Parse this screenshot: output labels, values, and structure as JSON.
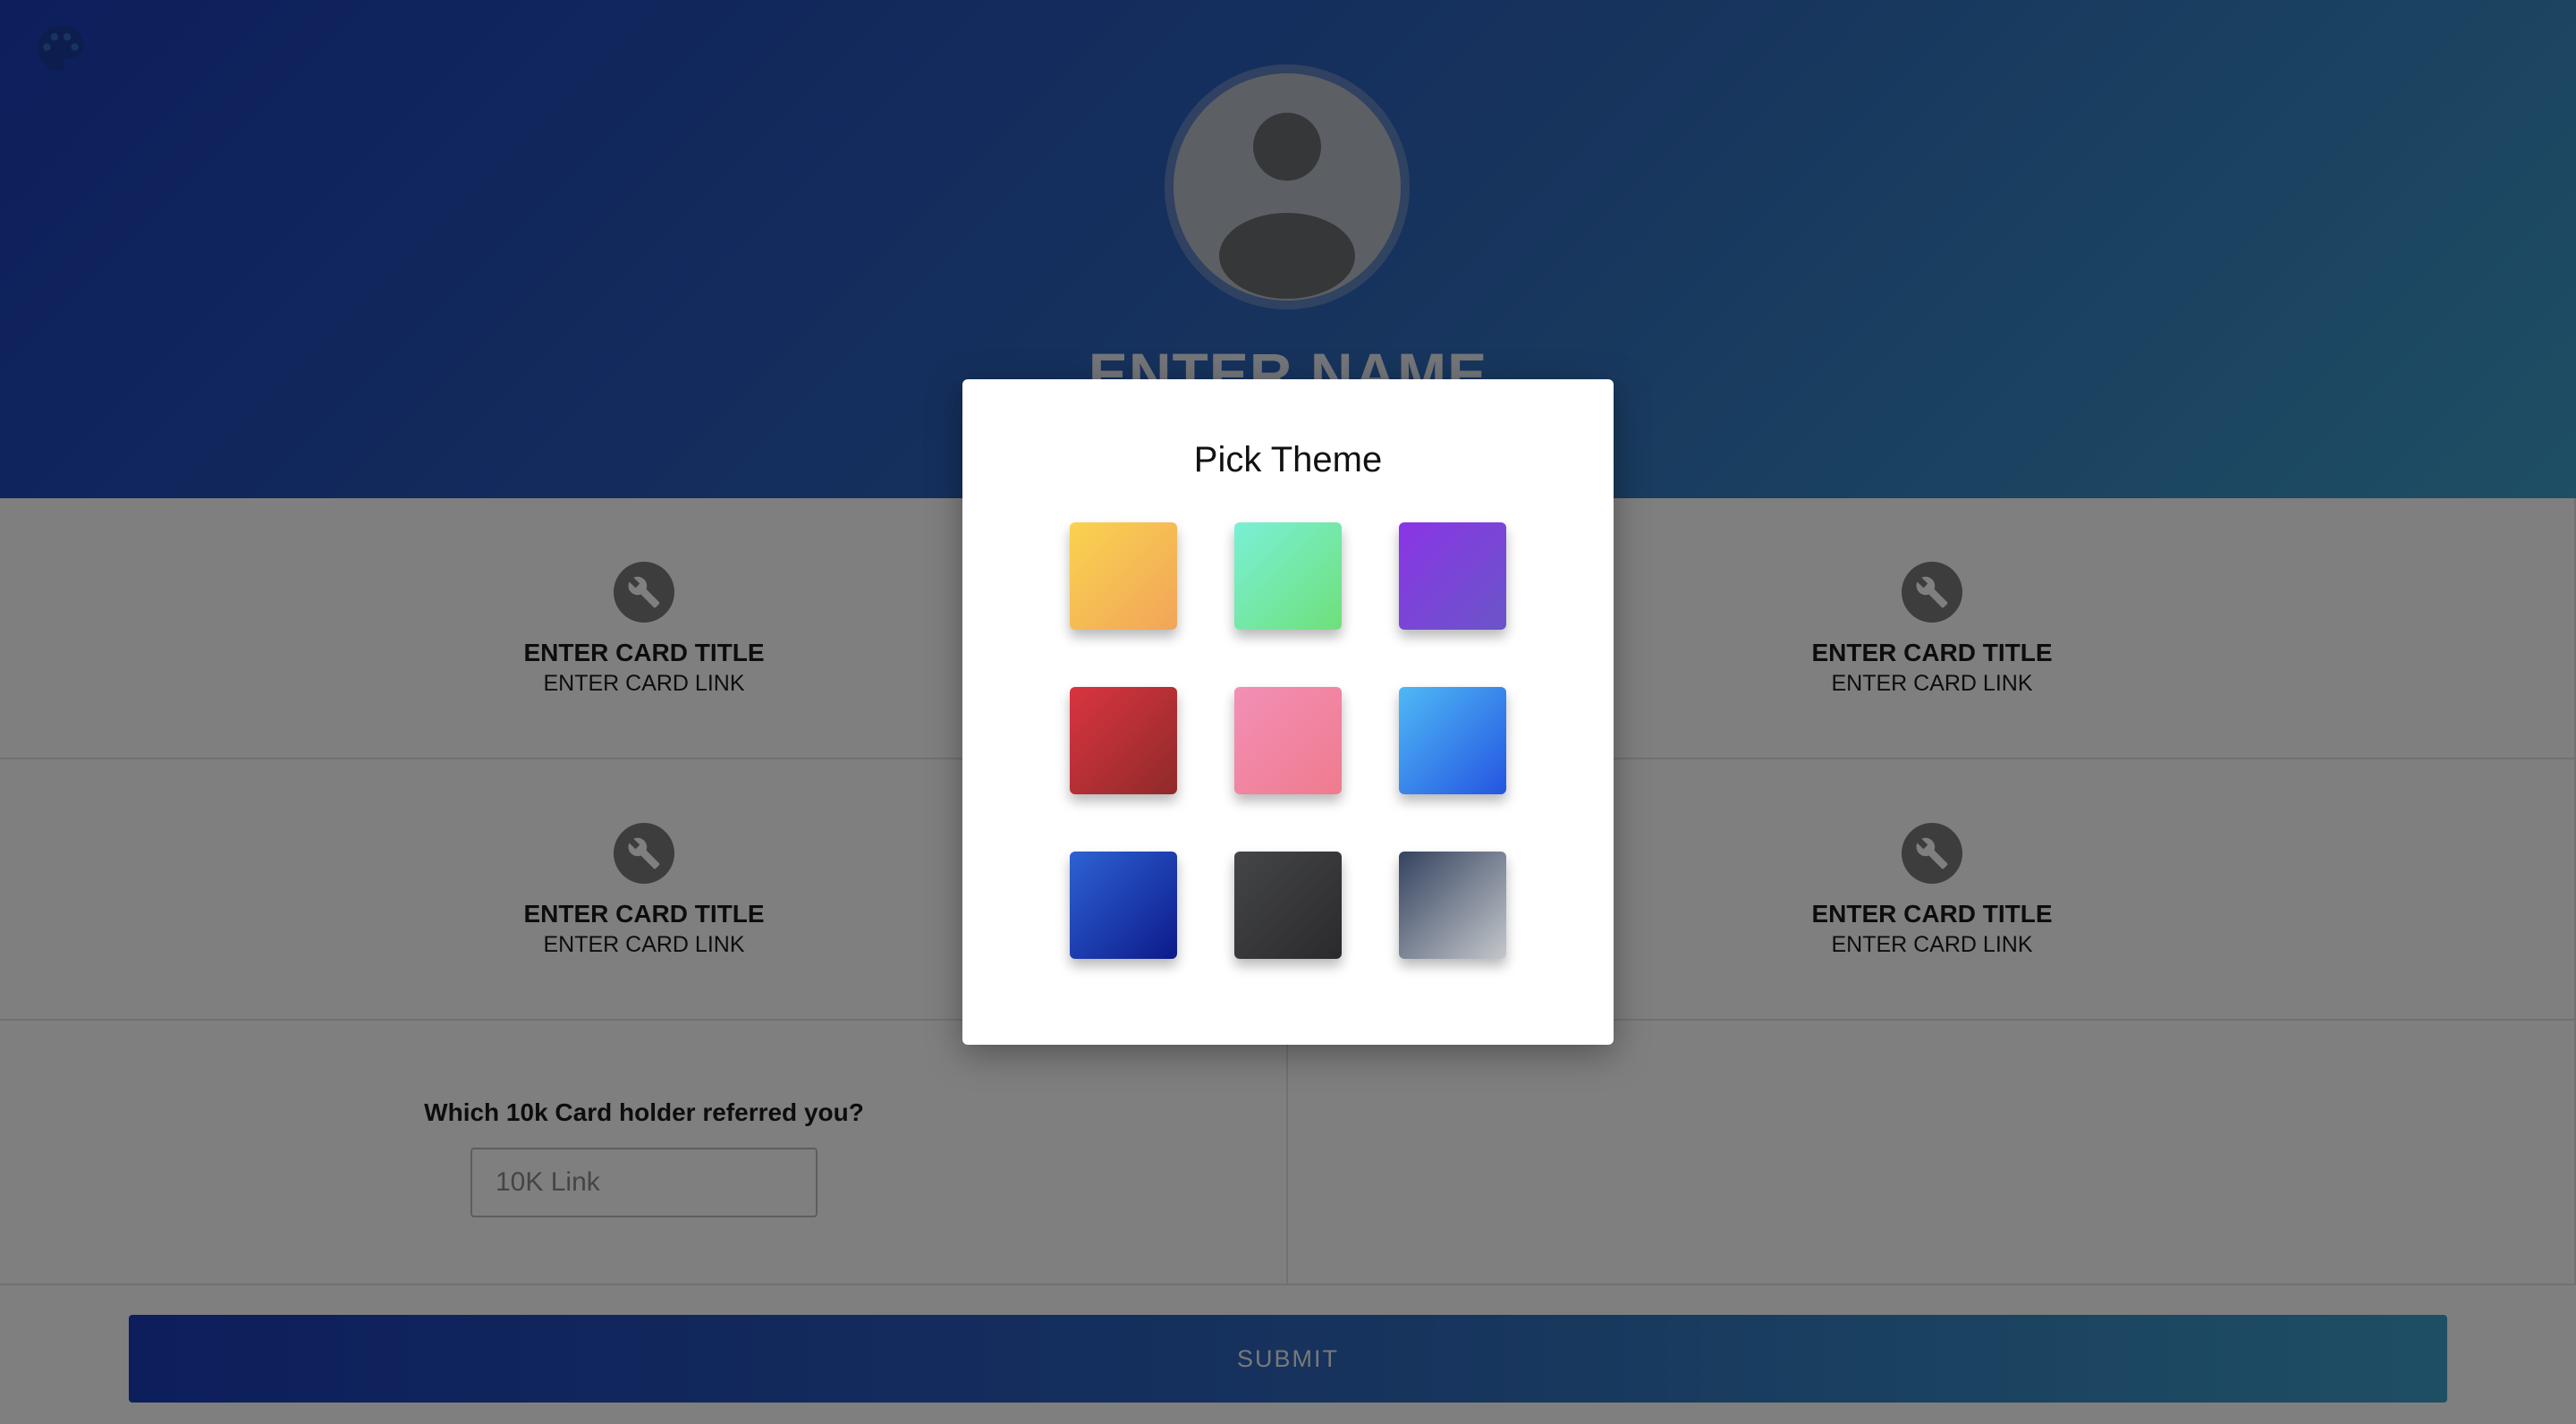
{
  "header": {
    "name_placeholder": "ENTER NAME",
    "palette_icon": "palette-icon",
    "avatar_icon": "user-avatar-icon"
  },
  "cards": [
    {
      "title": "ENTER CARD TITLE",
      "link": "ENTER CARD LINK",
      "icon": "wrench-icon"
    },
    {
      "title": "ENTER CARD TITLE",
      "link": "ENTER CARD LINK",
      "icon": "wrench-icon"
    },
    {
      "title": "ENTER CARD TITLE",
      "link": "ENTER CARD LINK",
      "icon": "wrench-icon"
    },
    {
      "title": "ENTER CARD TITLE",
      "link": "ENTER CARD LINK",
      "icon": "wrench-icon"
    }
  ],
  "referral": {
    "label": "Which 10k Card holder referred you?",
    "placeholder": "10K Link"
  },
  "submit_label": "SUBMIT",
  "theme_modal": {
    "title": "Pick Theme",
    "themes": [
      {
        "name": "yellow-orange",
        "from": "#f9d34f",
        "to": "#f2a45a"
      },
      {
        "name": "mint-green",
        "from": "#7af0d6",
        "to": "#6fe07a"
      },
      {
        "name": "purple",
        "from": "#8a35e6",
        "to": "#6a55c8"
      },
      {
        "name": "red",
        "from": "#d9353f",
        "to": "#8f2a2a"
      },
      {
        "name": "pink",
        "from": "#f38fb6",
        "to": "#ef7b8e"
      },
      {
        "name": "sky-blue",
        "from": "#4fb9f6",
        "to": "#2455e0"
      },
      {
        "name": "royal-blue",
        "from": "#2d62d4",
        "to": "#0d1a8a"
      },
      {
        "name": "charcoal",
        "from": "#454649",
        "to": "#2a2a2c"
      },
      {
        "name": "slate-gray",
        "from": "#34425e",
        "to": "#c4c8cc"
      }
    ]
  },
  "colors": {
    "header_gradient": [
      "#1a3cb8",
      "#2e68bb",
      "#3d9ec8"
    ],
    "overlay": "rgba(0,0,0,0.5)"
  }
}
